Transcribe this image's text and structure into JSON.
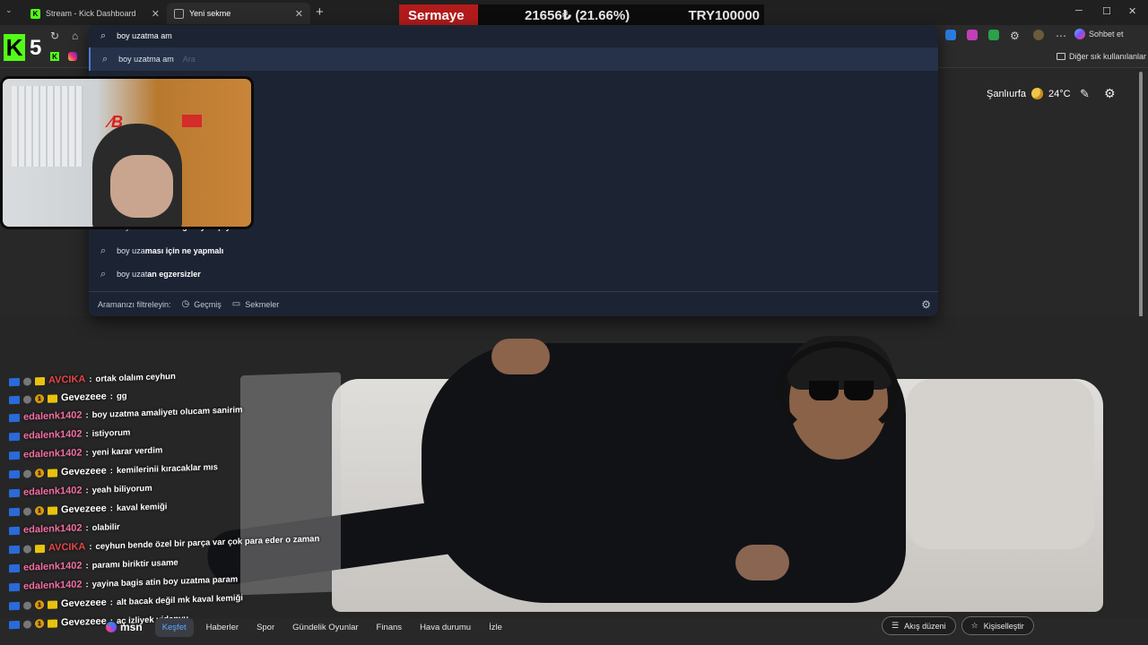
{
  "tabs": [
    {
      "label": "Stream - Kick Dashboard",
      "favicon": "kick-icon",
      "active": false
    },
    {
      "label": "Yeni sekme",
      "favicon": "new-tab-icon",
      "active": true
    }
  ],
  "ticker": {
    "label": "Sermaye",
    "value": "21656₺ (21.66%)",
    "target": "TRY100000"
  },
  "toolbar": {
    "chat_label": "Sohbet et"
  },
  "bookmarks": {
    "other_label": "Diğer sık kullanılanlar"
  },
  "overlay": {
    "digit": "5",
    "k_letter": "K",
    "mini_k": "K"
  },
  "search": {
    "value": "boy uzatma am",
    "suggestions": [
      {
        "prefix": "boy uzatma am",
        "bold": "",
        "ghost": "Ara"
      },
      {
        "prefix": "boy uza",
        "bold": "masını engelleyen şeyler"
      },
      {
        "prefix": "boy uza",
        "bold": "ması için ne yapmalı"
      },
      {
        "prefix": "boy uzat",
        "bold": "an egzersizler"
      }
    ],
    "filter_label": "Aramanızı filtreleyin:",
    "filter_history": "Geçmiş",
    "filter_tabs": "Sekmeler"
  },
  "weather": {
    "city": "Şanlıurfa",
    "temp": "24°C"
  },
  "chat": [
    {
      "user": "AVCIKA",
      "color": "red",
      "text": "ortak olalım ceyhun"
    },
    {
      "user": "Gevezeee",
      "color": "white",
      "text": "gg"
    },
    {
      "user": "edalenk1402",
      "color": "pink",
      "text": "boy uzatma amaliyetı olucam sanirim"
    },
    {
      "user": "edalenk1402",
      "color": "pink",
      "text": "istiyorum"
    },
    {
      "user": "edalenk1402",
      "color": "pink",
      "text": "yeni karar verdim"
    },
    {
      "user": "Gevezeee",
      "color": "white",
      "text": "kemilerinii kıracaklar mıs"
    },
    {
      "user": "edalenk1402",
      "color": "pink",
      "text": "yeah biliyorum"
    },
    {
      "user": "Gevezeee",
      "color": "white",
      "text": "kaval kemiği"
    },
    {
      "user": "edalenk1402",
      "color": "pink",
      "text": "olabilir"
    },
    {
      "user": "AVCIKA",
      "color": "red",
      "text": "ceyhun bende özel bir parça var çok para eder o zaman"
    },
    {
      "user": "edalenk1402",
      "color": "pink",
      "text": "paramı biriktir usame"
    },
    {
      "user": "edalenk1402",
      "color": "pink",
      "text": "yayina bagis atin boy uzatma param"
    },
    {
      "user": "Gevezeee",
      "color": "white",
      "text": "alt bacak değil mk kaval kemiği"
    },
    {
      "user": "Gevezeee",
      "color": "white",
      "text": "aç izliyek videpyu"
    }
  ],
  "msn": {
    "logo": "msn",
    "tabs": [
      "Keşfet",
      "Haberler",
      "Spor",
      "Gündelik Oyunlar",
      "Finans",
      "Hava durumu",
      "İzle"
    ],
    "feed_layout": "Akış düzeni",
    "personalize": "Kişiselleştir"
  },
  "colors": {
    "kick_green": "#53fc18",
    "ticker_red": "#b31b1b",
    "dropdown_bg": "#1c2433",
    "accent_blue": "#5aa9ff"
  }
}
